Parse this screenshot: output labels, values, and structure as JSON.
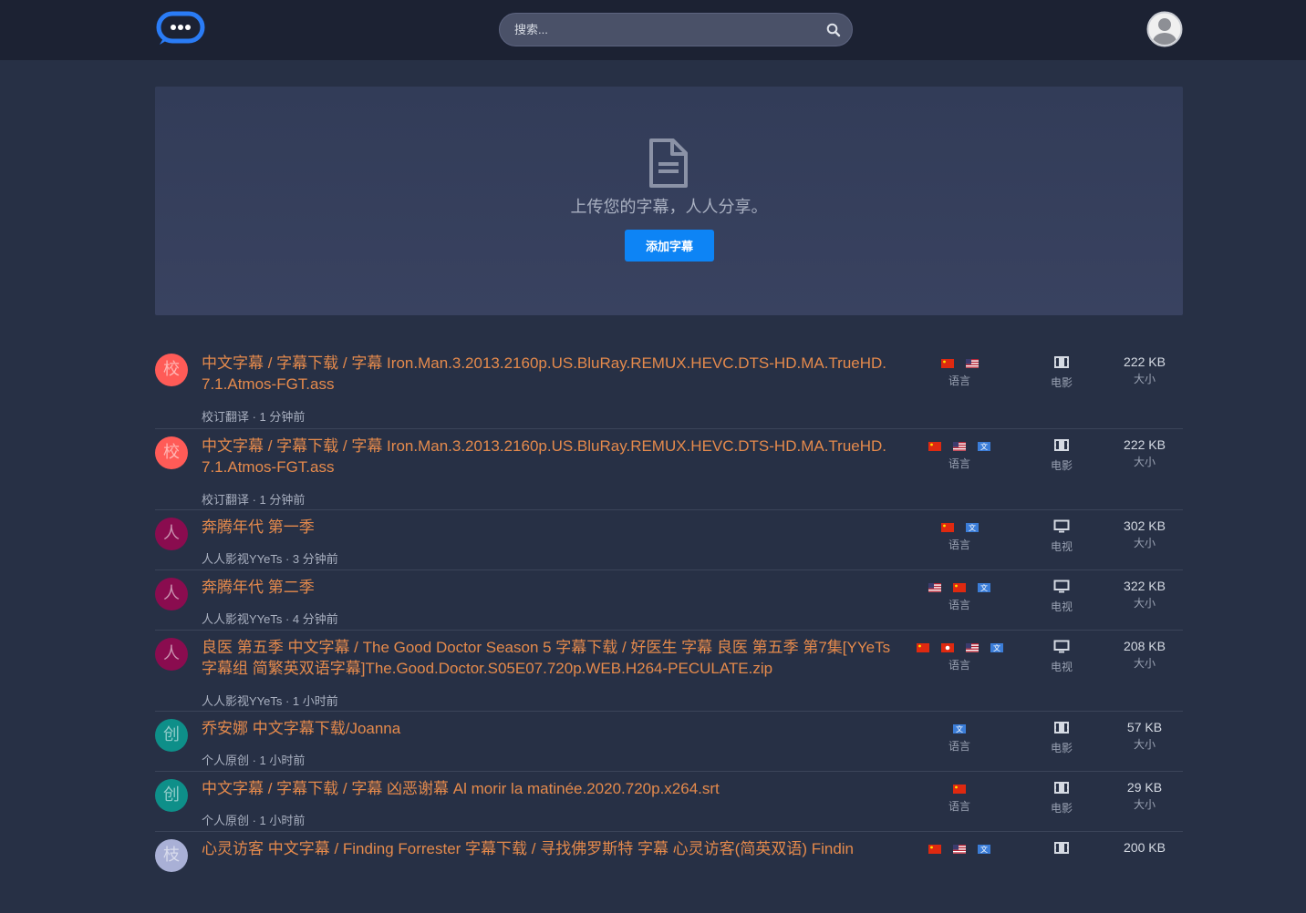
{
  "search": {
    "placeholder": "搜索..."
  },
  "hero": {
    "text": "上传您的字幕，人人分享。",
    "button": "添加字幕"
  },
  "labels": {
    "language": "语言",
    "size": "大小"
  },
  "colors": {
    "accent": "#0d84f5",
    "title": "#e58a4c",
    "background": "#273045",
    "navbar": "#1c2233"
  },
  "items": [
    {
      "badge": "校",
      "badge_color": "#ff5b57",
      "title": "中文字幕 / 字幕下载 / 字幕 Iron.Man.3.2013.2160p.US.BluRay.REMUX.HEVC.DTS-HD.MA.TrueHD.7.1.Atmos-FGT.ass",
      "meta": "校订翻译 · 1 分钟前",
      "flags": [
        "cn",
        "us"
      ],
      "type": "电影",
      "type_icon": "film-icon",
      "size": "222 KB"
    },
    {
      "badge": "校",
      "badge_color": "#ff5b57",
      "title": "中文字幕 / 字幕下载 / 字幕 Iron.Man.3.2013.2160p.US.BluRay.REMUX.HEVC.DTS-HD.MA.TrueHD.7.1.Atmos-FGT.ass",
      "meta": "校订翻译 · 1 分钟前",
      "flags": [
        "cn",
        "us",
        "translate"
      ],
      "type": "电影",
      "type_icon": "film-icon",
      "size": "222 KB"
    },
    {
      "badge": "人",
      "badge_color": "#8a0c4f",
      "title": "奔腾年代 第一季",
      "meta": "人人影视YYeTs · 3 分钟前",
      "flags": [
        "cn",
        "translate"
      ],
      "type": "电视",
      "type_icon": "tv-icon",
      "size": "302 KB"
    },
    {
      "badge": "人",
      "badge_color": "#8a0c4f",
      "title": "奔腾年代 第二季",
      "meta": "人人影视YYeTs · 4 分钟前",
      "flags": [
        "us",
        "cn",
        "translate"
      ],
      "type": "电视",
      "type_icon": "tv-icon",
      "size": "322 KB"
    },
    {
      "badge": "人",
      "badge_color": "#8a0c4f",
      "title": "良医 第五季 中文字幕 / The Good Doctor Season 5 字幕下载 / 好医生 字幕 良医 第五季 第7集[YYeTs字幕组 简繁英双语字幕]The.Good.Doctor.S05E07.720p.WEB.H264-PECULATE.zip",
      "meta": "人人影视YYeTs · 1 小时前",
      "flags": [
        "cn",
        "hk",
        "us",
        "translate"
      ],
      "type": "电视",
      "type_icon": "tv-icon",
      "size": "208 KB"
    },
    {
      "badge": "创",
      "badge_color": "#0e8f89",
      "title": "乔安娜 中文字幕下载/Joanna",
      "meta": "个人原创 · 1 小时前",
      "flags": [
        "translate"
      ],
      "type": "电影",
      "type_icon": "film-icon",
      "size": "57 KB"
    },
    {
      "badge": "创",
      "badge_color": "#0e8f89",
      "title": "中文字幕 / 字幕下载 / 字幕 凶恶谢幕 Al morir la matinée.2020.720p.x264.srt",
      "meta": "个人原创 · 1 小时前",
      "flags": [
        "cn"
      ],
      "type": "电影",
      "type_icon": "film-icon",
      "size": "29 KB"
    },
    {
      "badge": "枝",
      "badge_color": "#a9b0d6",
      "title": "心灵访客 中文字幕 / Finding Forrester 字幕下载 / 寻找佛罗斯特 字幕 心灵访客(简英双语) Findin",
      "meta": "",
      "flags": [
        "cn",
        "us",
        "translate"
      ],
      "type": "电影",
      "type_icon": "film-icon",
      "size": "200 KB"
    }
  ]
}
